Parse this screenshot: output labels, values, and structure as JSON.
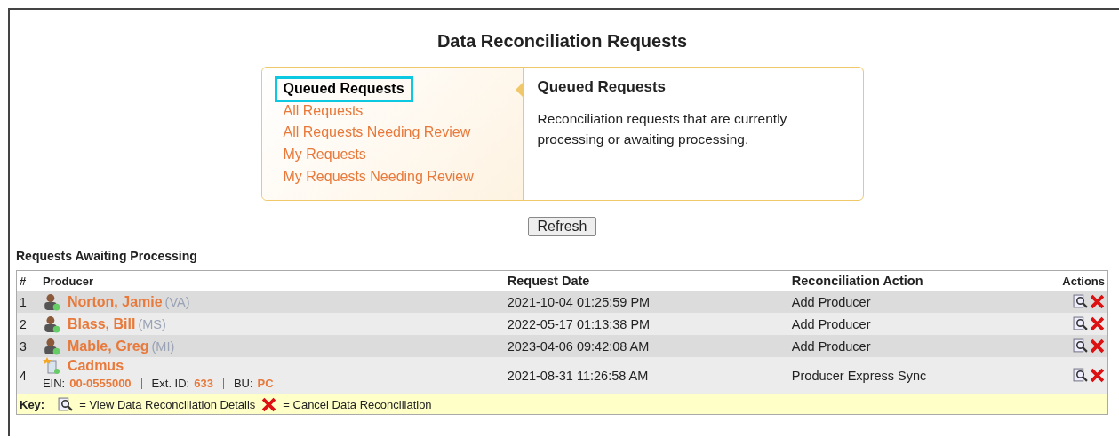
{
  "title": "Data Reconciliation Requests",
  "views": [
    {
      "label": "Queued Requests",
      "selected": true
    },
    {
      "label": "All Requests",
      "selected": false
    },
    {
      "label": "All Requests Needing Review",
      "selected": false
    },
    {
      "label": "My Requests",
      "selected": false
    },
    {
      "label": "My Requests Needing Review",
      "selected": false
    }
  ],
  "description": {
    "heading": "Queued Requests",
    "text": "Reconciliation requests that are currently processing or awaiting processing."
  },
  "refresh_button": "Refresh",
  "section_title": "Requests Awaiting Processing",
  "table": {
    "columns": [
      "#",
      "Producer",
      "Request Date",
      "Reconciliation Action",
      "Actions"
    ],
    "rows": [
      {
        "kind": "person",
        "number": "1",
        "name": "Norton, Jamie",
        "state": "(VA)",
        "date": "2021-10-04 01:25:59 PM",
        "action": "Add Producer"
      },
      {
        "kind": "person",
        "number": "2",
        "name": "Blass, Bill",
        "state": "(MS)",
        "date": "2022-05-17 01:13:38 PM",
        "action": "Add Producer"
      },
      {
        "kind": "person",
        "number": "3",
        "name": "Mable, Greg",
        "state": "(MI)",
        "date": "2023-04-06 09:42:08 AM",
        "action": "Add Producer"
      },
      {
        "kind": "company",
        "number": "4",
        "name": "Cadmus",
        "details": [
          {
            "label": "EIN:",
            "value": "00-0555000"
          },
          {
            "label": "Ext. ID:",
            "value": "633"
          },
          {
            "label": "BU:",
            "value": "PC"
          }
        ],
        "date": "2021-08-31 11:26:58 AM",
        "action": "Producer Express Sync"
      }
    ]
  },
  "key": {
    "label": "Key:",
    "view": "= View Data Reconciliation Details",
    "cancel": "= Cancel Data Reconciliation"
  }
}
